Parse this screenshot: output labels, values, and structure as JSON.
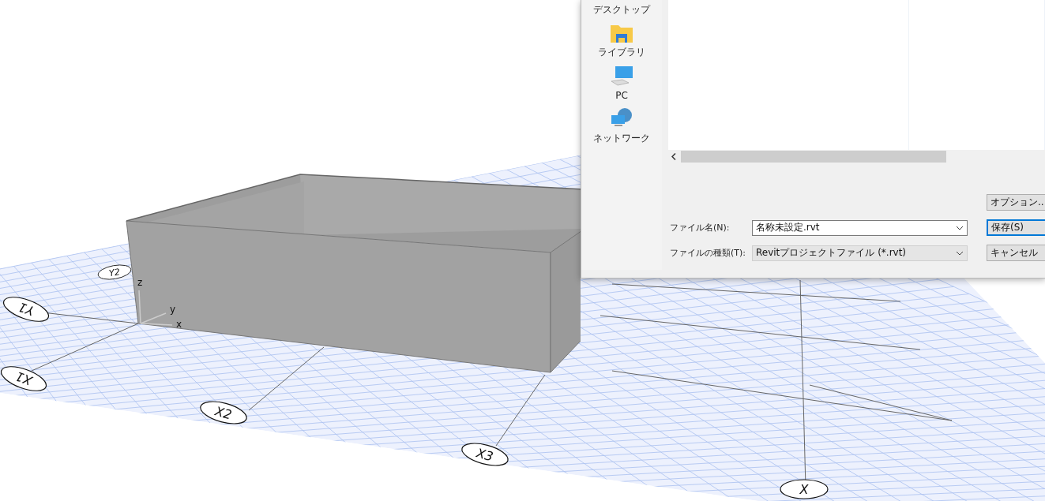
{
  "viewport": {
    "grid_bubbles": [
      {
        "label": "Y2"
      },
      {
        "label": "Y1"
      },
      {
        "label": "X1"
      },
      {
        "label": "X2"
      },
      {
        "label": "X3"
      },
      {
        "label": "X"
      }
    ],
    "axes": {
      "x": "x",
      "y": "y",
      "z": "z"
    }
  },
  "dialog": {
    "places": [
      {
        "label": "デスクトップ",
        "kind": "desktop"
      },
      {
        "label": "ライブラリ",
        "kind": "library"
      },
      {
        "label": "PC",
        "kind": "pc"
      },
      {
        "label": "ネットワーク",
        "kind": "network"
      }
    ],
    "fields": [
      {
        "label": "ファイル名(N):",
        "value": "名称未設定.rvt",
        "kind": "combo"
      },
      {
        "label": "ファイルの種類(T):",
        "value": "Revitプロジェクトファイル (*.rvt)",
        "kind": "select"
      }
    ],
    "buttons": [
      {
        "label": "オプション..",
        "kind": "plain"
      },
      {
        "label": "保存(S)",
        "kind": "default"
      },
      {
        "label": "キャンセル",
        "kind": "plain"
      }
    ]
  }
}
